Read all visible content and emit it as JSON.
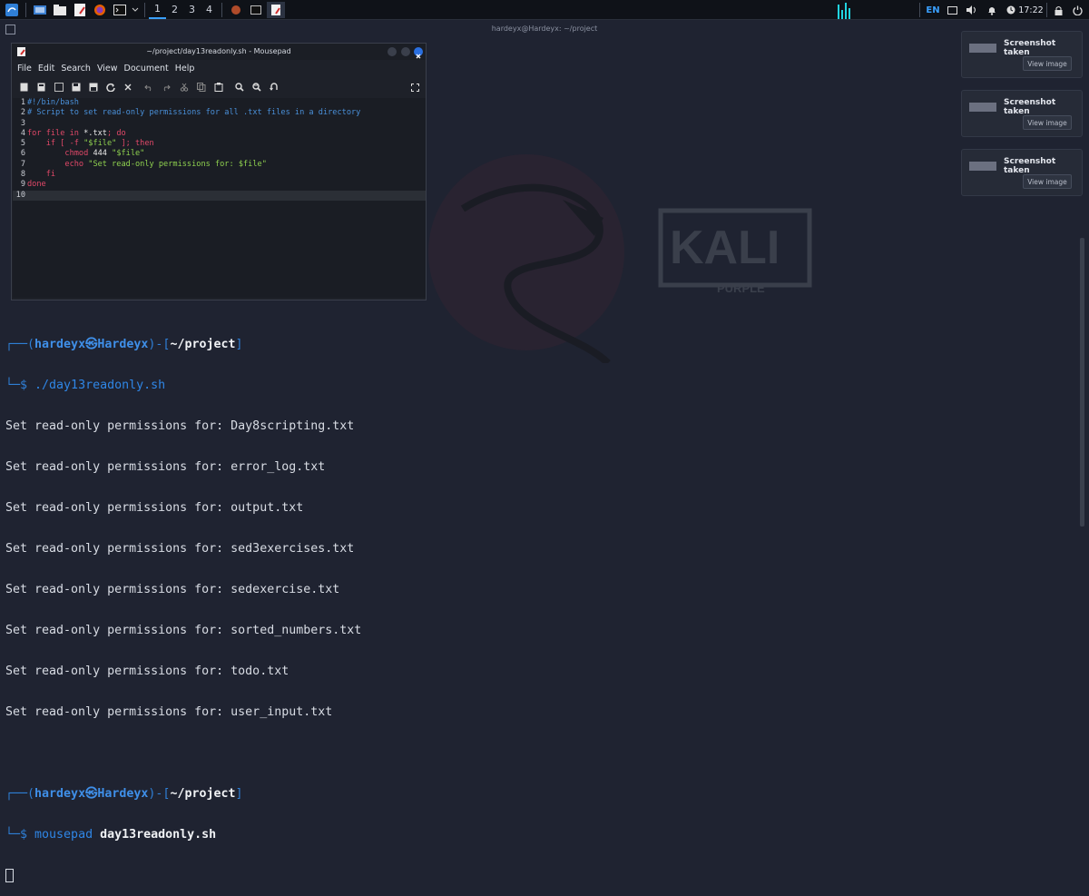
{
  "panel": {
    "workspaces": [
      "1",
      "2",
      "3",
      "4"
    ],
    "active_workspace": "1",
    "icons": [
      "kali-menu-icon",
      "show-desktop-icon",
      "file-manager-icon",
      "text-editor-icon",
      "firefox-icon",
      "terminal-icon"
    ],
    "tray": {
      "lang": "EN",
      "clock": "17:22"
    }
  },
  "terminal": {
    "title": "hardeyx@Hardeyx: ~/project",
    "prompt1": {
      "user": "hardeyx㉿Hardeyx",
      "path": "~/project",
      "cmd": "./day13readonly.sh"
    },
    "output": [
      "Set read-only permissions for: Day8scripting.txt",
      "Set read-only permissions for: error_log.txt",
      "Set read-only permissions for: output.txt",
      "Set read-only permissions for: sed3exercises.txt",
      "Set read-only permissions for: sedexercise.txt",
      "Set read-only permissions for: sorted_numbers.txt",
      "Set read-only permissions for: todo.txt",
      "Set read-only permissions for: user_input.txt"
    ],
    "prompt2": {
      "user": "hardeyx㉿Hardeyx",
      "path": "~/project",
      "cmd": "mousepad",
      "arg": "day13readonly.sh"
    }
  },
  "background": {
    "logo_text": "KALI",
    "logo_sub": "PURPLE"
  },
  "notifications": [
    {
      "title": "Screenshot taken",
      "button": "View image"
    },
    {
      "title": "Screenshot taken",
      "button": "View image"
    },
    {
      "title": "Screenshot taken",
      "button": "View image"
    }
  ],
  "mousepad": {
    "title": "~/project/day13readonly.sh - Mousepad",
    "menu": [
      "File",
      "Edit",
      "Search",
      "View",
      "Document",
      "Help"
    ],
    "lines": [
      {
        "n": "1",
        "parts": [
          {
            "t": "#!/bin/bash",
            "c": "cm"
          }
        ]
      },
      {
        "n": "2",
        "parts": [
          {
            "t": "# Script to set read-only permissions for all .txt files in a directory",
            "c": "cm"
          }
        ]
      },
      {
        "n": "3",
        "parts": []
      },
      {
        "n": "4",
        "parts": [
          {
            "t": "for file in ",
            "c": "kw"
          },
          {
            "t": "*.txt",
            "c": "op"
          },
          {
            "t": "; do",
            "c": "kw"
          }
        ]
      },
      {
        "n": "5",
        "parts": [
          {
            "t": "    if [ -f ",
            "c": "kw"
          },
          {
            "t": "\"$file\"",
            "c": "st"
          },
          {
            "t": " ]; then",
            "c": "kw"
          }
        ]
      },
      {
        "n": "6",
        "parts": [
          {
            "t": "        chmod ",
            "c": "cmdc"
          },
          {
            "t": "444 ",
            "c": "op"
          },
          {
            "t": "\"$file\"",
            "c": "st"
          }
        ]
      },
      {
        "n": "7",
        "parts": [
          {
            "t": "        echo ",
            "c": "cmdc"
          },
          {
            "t": "\"Set read-only permissions for: $file\"",
            "c": "st"
          }
        ]
      },
      {
        "n": "8",
        "parts": [
          {
            "t": "    fi",
            "c": "kw"
          }
        ]
      },
      {
        "n": "9",
        "parts": [
          {
            "t": "done",
            "c": "kw"
          }
        ]
      },
      {
        "n": "10",
        "parts": []
      }
    ],
    "current_line": "10"
  },
  "colors": {
    "accent": "#3aa0ff",
    "keyword": "#e14868",
    "comment": "#4a90d9",
    "string": "#8fd14f"
  }
}
